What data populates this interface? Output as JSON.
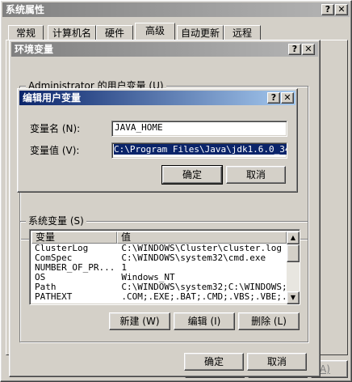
{
  "sys_props": {
    "title": "系统属性",
    "help_btn": "?",
    "close_btn": "✕",
    "tabs": [
      "常规",
      "计算机名",
      "硬件",
      "高级",
      "自动更新",
      "远程"
    ],
    "ok": "确定",
    "cancel": "取消",
    "apply_fragment": "A)"
  },
  "env_vars": {
    "title": "环境变量",
    "help_btn": "?",
    "close_btn": "✕",
    "user_group_label": "Administrator 的用户变量 (U)",
    "system_group_label": "系统变量 (S)",
    "columns": [
      "变量",
      "值"
    ],
    "system_vars": [
      {
        "name": "ClusterLog",
        "value": "C:\\WINDOWS\\Cluster\\cluster.log"
      },
      {
        "name": "ComSpec",
        "value": "C:\\WINDOWS\\system32\\cmd.exe"
      },
      {
        "name": "NUMBER_OF_PR...",
        "value": "1"
      },
      {
        "name": "OS",
        "value": "Windows_NT"
      },
      {
        "name": "Path",
        "value": "C:\\WINDOWS\\system32;C:\\WINDOWS;..."
      },
      {
        "name": "PATHEXT",
        "value": ".COM;.EXE;.BAT;.CMD;.VBS;.VBE;..."
      }
    ],
    "new_btn": "新建 (W)",
    "edit_btn": "编辑 (I)",
    "delete_btn": "删除 (L)",
    "ok": "确定",
    "cancel": "取消"
  },
  "edit_var": {
    "title": "编辑用户变量",
    "help_btn": "?",
    "close_btn": "✕",
    "name_label": "变量名 (N):",
    "name_value": "JAVA_HOME",
    "value_label": "变量值 (V):",
    "value_value": "C:\\Program Files\\Java\\jdk1.6.0_34",
    "ok": "确定",
    "cancel": "取消"
  }
}
